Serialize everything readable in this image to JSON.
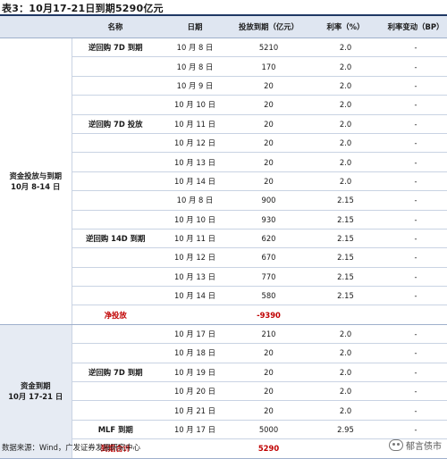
{
  "title": "表3：10月17-21日到期5290亿元",
  "headers": [
    "名称",
    "日期",
    "投放到期（亿元）",
    "利率（%）",
    "利率变动（BP）"
  ],
  "section1": {
    "group_label_line1": "资金投放与到期",
    "group_label_line2": "10月 8-14 日",
    "rows": [
      {
        "name": "逆回购 7D 到期",
        "date": "10 月 8 日",
        "amount": "5210",
        "rate": "2.0",
        "change": "-"
      },
      {
        "name": "",
        "date": "10 月 8 日",
        "amount": "170",
        "rate": "2.0",
        "change": "-"
      },
      {
        "name": "",
        "date": "10 月 9 日",
        "amount": "20",
        "rate": "2.0",
        "change": "-"
      },
      {
        "name": "",
        "date": "10 月 10 日",
        "amount": "20",
        "rate": "2.0",
        "change": "-"
      },
      {
        "name": "逆回购 7D 投放",
        "date": "10 月 11 日",
        "amount": "20",
        "rate": "2.0",
        "change": "-"
      },
      {
        "name": "",
        "date": "10 月 12 日",
        "amount": "20",
        "rate": "2.0",
        "change": "-"
      },
      {
        "name": "",
        "date": "10 月 13 日",
        "amount": "20",
        "rate": "2.0",
        "change": "-"
      },
      {
        "name": "",
        "date": "10 月 14 日",
        "amount": "20",
        "rate": "2.0",
        "change": "-"
      },
      {
        "name": "",
        "date": "10 月 8 日",
        "amount": "900",
        "rate": "2.15",
        "change": "-"
      },
      {
        "name": "",
        "date": "10 月 10 日",
        "amount": "930",
        "rate": "2.15",
        "change": "-"
      },
      {
        "name": "逆回购 14D 到期",
        "date": "10 月 11 日",
        "amount": "620",
        "rate": "2.15",
        "change": "-"
      },
      {
        "name": "",
        "date": "10 月 12 日",
        "amount": "670",
        "rate": "2.15",
        "change": "-"
      },
      {
        "name": "",
        "date": "10 月 13 日",
        "amount": "770",
        "rate": "2.15",
        "change": "-"
      },
      {
        "name": "",
        "date": "10 月 14 日",
        "amount": "580",
        "rate": "2.15",
        "change": "-"
      }
    ],
    "net": {
      "name": "净投放",
      "amount": "-9390"
    }
  },
  "section2": {
    "group_label_line1": "资金到期",
    "group_label_line2": "10月 17-21 日",
    "rows": [
      {
        "name": "",
        "date": "10 月 17 日",
        "amount": "210",
        "rate": "2.0",
        "change": "-"
      },
      {
        "name": "",
        "date": "10 月 18 日",
        "amount": "20",
        "rate": "2.0",
        "change": "-"
      },
      {
        "name": "逆回购 7D 到期",
        "date": "10 月 19 日",
        "amount": "20",
        "rate": "2.0",
        "change": "-"
      },
      {
        "name": "",
        "date": "10 月 20 日",
        "amount": "20",
        "rate": "2.0",
        "change": "-"
      },
      {
        "name": "",
        "date": "10 月 21 日",
        "amount": "20",
        "rate": "2.0",
        "change": "-"
      },
      {
        "name": "MLF 到期",
        "date": "10 月 17 日",
        "amount": "5000",
        "rate": "2.95",
        "change": "-"
      }
    ],
    "sum": {
      "name": "到期合计",
      "amount": "5290"
    }
  },
  "source": "数据来源：Wind，广发证券发展研究中心",
  "watermark": "郁言债市"
}
